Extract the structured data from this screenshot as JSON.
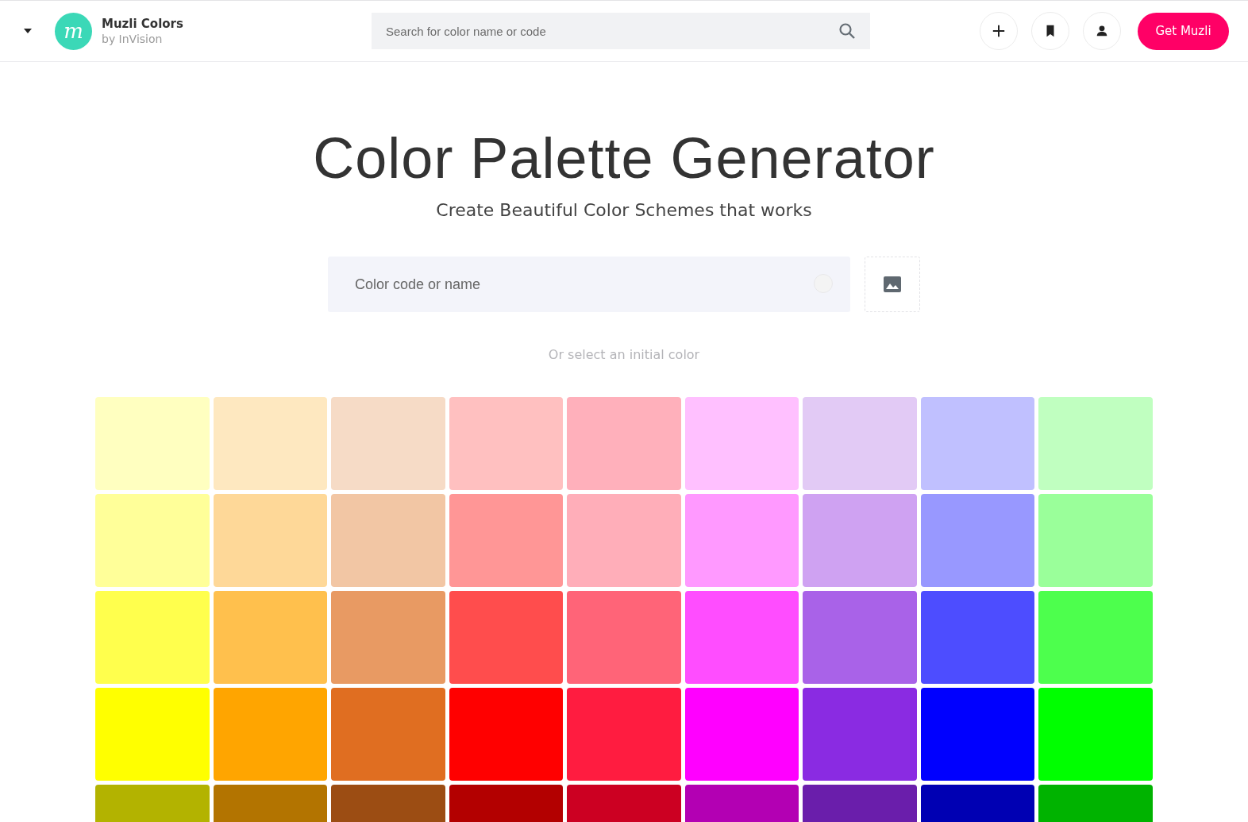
{
  "header": {
    "brand": {
      "logo_letter": "m",
      "name": "Muzli Colors",
      "byline": "by InVision"
    },
    "search": {
      "placeholder": "Search for color name or code"
    },
    "cta": "Get Muzli"
  },
  "hero": {
    "title": "Color Palette Generator",
    "subtitle": "Create Beautiful Color Schemes that works"
  },
  "color_input": {
    "placeholder": "Color code or name"
  },
  "hint": "Or select an initial color",
  "swatch_rows": [
    {
      "swatches": [
        {
          "color": "#ffffc0"
        },
        {
          "color": "#fee8c0"
        },
        {
          "color": "#f6dbc6"
        },
        {
          "color": "#ffc0c0"
        },
        {
          "color": "#ffb0bb"
        },
        {
          "color": "#ffc0ff"
        },
        {
          "color": "#e2caf5"
        },
        {
          "color": "#c0c0ff"
        },
        {
          "color": "#c0ffc0"
        }
      ]
    },
    {
      "swatches": [
        {
          "color": "#ffff99"
        },
        {
          "color": "#fed898"
        },
        {
          "color": "#f2c6a4"
        },
        {
          "color": "#ff9696"
        },
        {
          "color": "#ffaeb9"
        },
        {
          "color": "#ff99ff"
        },
        {
          "color": "#cfa2f2"
        },
        {
          "color": "#9898ff"
        },
        {
          "color": "#9aff9a"
        }
      ]
    },
    {
      "swatches": [
        {
          "color": "#ffff4d"
        },
        {
          "color": "#ffc04d"
        },
        {
          "color": "#e89a63"
        },
        {
          "color": "#ff4d4d"
        },
        {
          "color": "#ff6478"
        },
        {
          "color": "#ff4dff"
        },
        {
          "color": "#a962e8"
        },
        {
          "color": "#4d4dff"
        },
        {
          "color": "#4dff4d"
        }
      ]
    },
    {
      "swatches": [
        {
          "color": "#ffff00"
        },
        {
          "color": "#ffa500"
        },
        {
          "color": "#e06e21"
        },
        {
          "color": "#ff0000"
        },
        {
          "color": "#ff1c40"
        },
        {
          "color": "#ff00ff"
        },
        {
          "color": "#8a2be2"
        },
        {
          "color": "#0000ff"
        },
        {
          "color": "#00ff00"
        }
      ]
    },
    {
      "swatches": [
        {
          "color": "#b3b300"
        },
        {
          "color": "#b37400"
        },
        {
          "color": "#9c4d13"
        },
        {
          "color": "#b30000"
        },
        {
          "color": "#cc0022"
        },
        {
          "color": "#b300b3"
        },
        {
          "color": "#6a1eab"
        },
        {
          "color": "#0000b3"
        },
        {
          "color": "#00b300"
        }
      ]
    }
  ]
}
